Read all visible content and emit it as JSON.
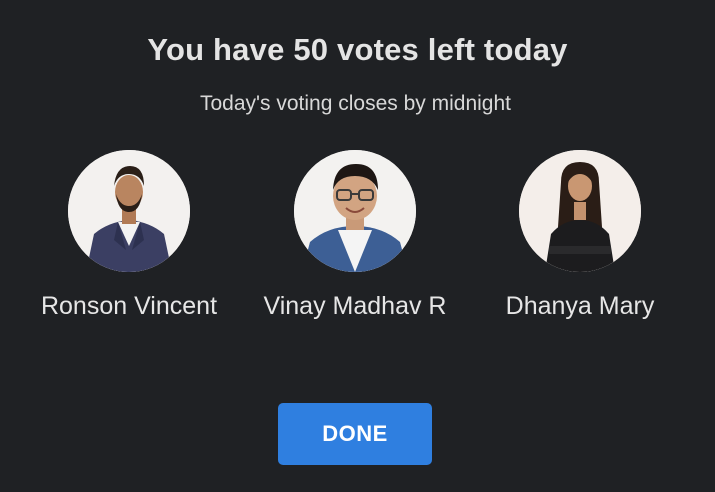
{
  "header": {
    "title": "You have 50 votes left today",
    "subtitle": "Today's voting closes by midnight"
  },
  "contestants": [
    {
      "name": "Ronson Vincent",
      "avatar_icon": "man-in-navy-suit-photo"
    },
    {
      "name": "Vinay Madhav R",
      "avatar_icon": "man-in-glasses-denim-jacket-photo"
    },
    {
      "name": "Dhanya Mary",
      "avatar_icon": "woman-in-black-outfit-photo"
    }
  ],
  "actions": {
    "done_label": "DONE"
  },
  "colors": {
    "background": "#1f2124",
    "button": "#2f7fe0",
    "text": "#e6e6e6"
  }
}
